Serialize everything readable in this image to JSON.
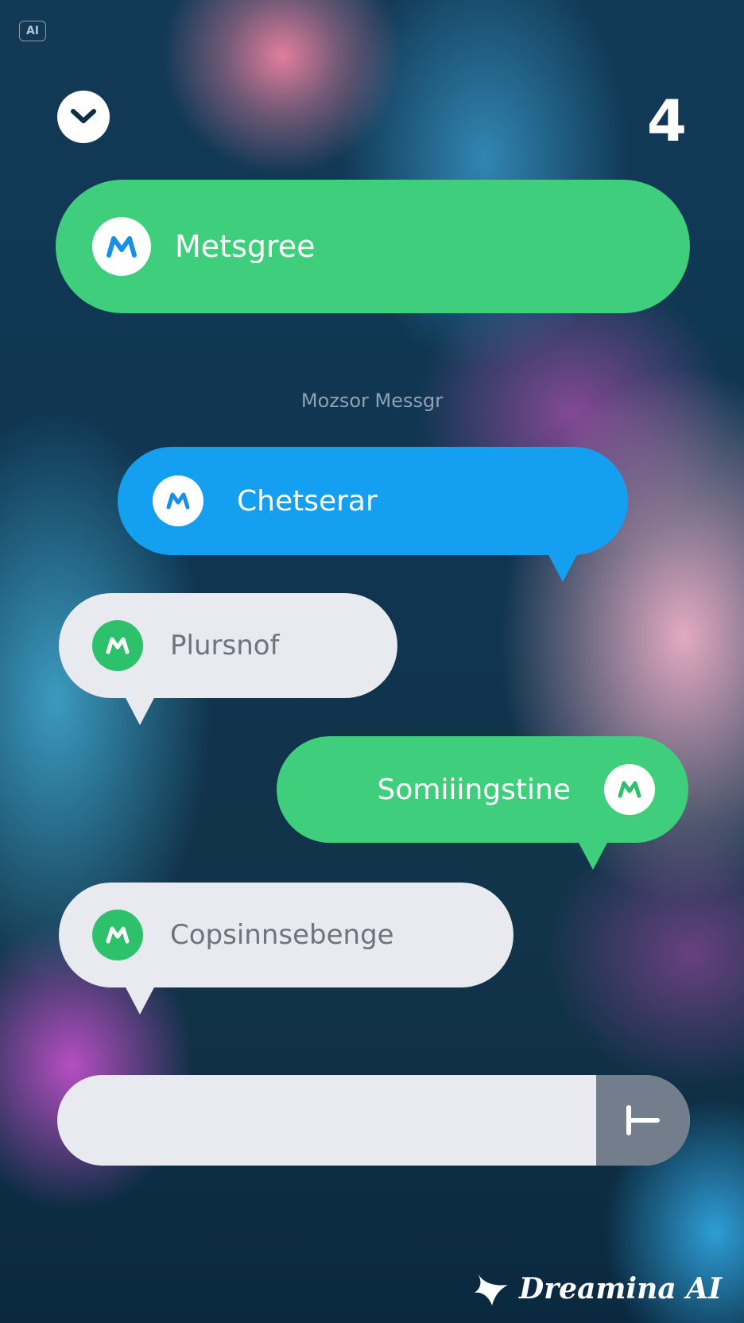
{
  "badge": {
    "label": "AI"
  },
  "header": {
    "count": "4"
  },
  "top_pill": {
    "label": "Metsgree"
  },
  "section": {
    "label": "Mozsor Messgr"
  },
  "messages": [
    {
      "text": "Chetserar",
      "style": "blue",
      "align": "right-tail"
    },
    {
      "text": "Plursnof",
      "style": "white",
      "align": "left-tail"
    },
    {
      "text": "Somiiingstine",
      "style": "green",
      "align": "right-tail"
    },
    {
      "text": "Copsinnsebenge",
      "style": "white",
      "align": "left-tail"
    }
  ],
  "composer": {
    "value": "",
    "placeholder": ""
  },
  "watermark": {
    "text": "Dreamina AI"
  },
  "colors": {
    "green": "#3ece7c",
    "blue": "#159ff0",
    "bubble_white": "#e9eaf0",
    "send_gray": "#737e8c",
    "logo_blue": "#1a8fe6",
    "logo_green": "#2ec16b"
  },
  "icons": {
    "check": "chevron-down-icon",
    "app_logo": "messenger-logo-icon",
    "send": "send-t-icon"
  }
}
